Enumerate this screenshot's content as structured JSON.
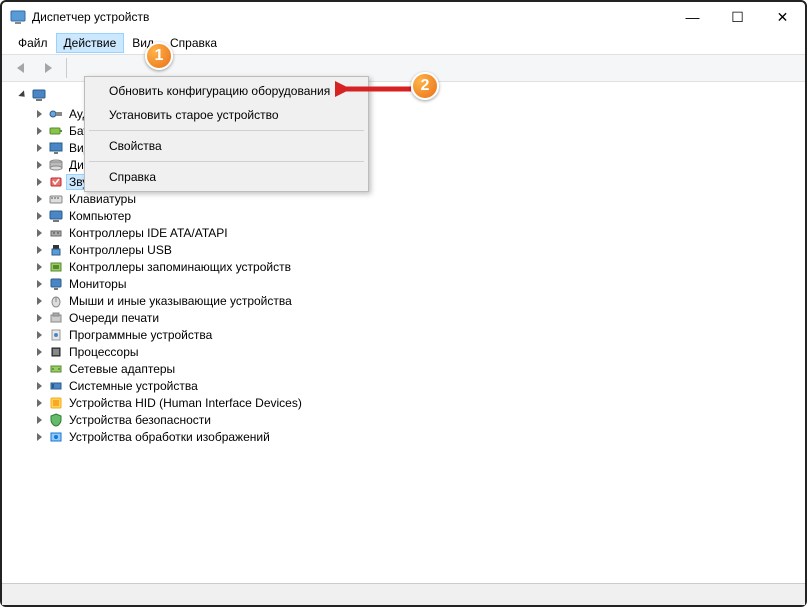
{
  "window": {
    "title": "Диспетчер устройств"
  },
  "menubar": {
    "file": "Файл",
    "action": "Действие",
    "view": "Вид",
    "help": "Справка"
  },
  "dropdown": {
    "refresh": "Обновить конфигурацию оборудования",
    "addLegacy": "Установить старое устройство",
    "properties": "Свойства",
    "help": "Справка"
  },
  "tree": {
    "items": [
      {
        "label": "Аудиовходы и аудиовыходы"
      },
      {
        "label": "Батареи"
      },
      {
        "label": "Видеоадаптеры"
      },
      {
        "label": "Дисковые устройства"
      },
      {
        "label": "Звуковые, игровые и видеоустройства",
        "selected": true
      },
      {
        "label": "Клавиатуры"
      },
      {
        "label": "Компьютер"
      },
      {
        "label": "Контроллеры IDE ATA/ATAPI"
      },
      {
        "label": "Контроллеры USB"
      },
      {
        "label": "Контроллеры запоминающих устройств"
      },
      {
        "label": "Мониторы"
      },
      {
        "label": "Мыши и иные указывающие устройства"
      },
      {
        "label": "Очереди печати"
      },
      {
        "label": "Программные устройства"
      },
      {
        "label": "Процессоры"
      },
      {
        "label": "Сетевые адаптеры"
      },
      {
        "label": "Системные устройства"
      },
      {
        "label": "Устройства HID (Human Interface Devices)"
      },
      {
        "label": "Устройства безопасности"
      },
      {
        "label": "Устройства обработки изображений"
      }
    ]
  },
  "markers": {
    "m1": "1",
    "m2": "2"
  }
}
